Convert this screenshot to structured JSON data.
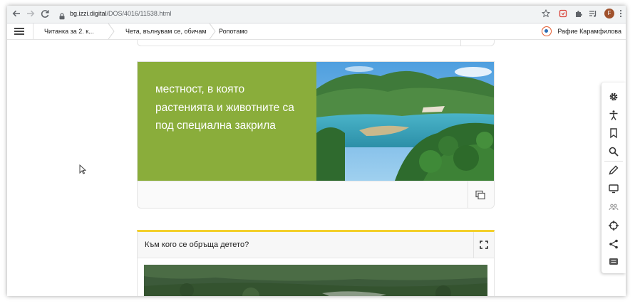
{
  "browser": {
    "url_domain": "bg.izzi.digital",
    "url_path": "/DOS/4016/11538.html",
    "profile_initial": "F"
  },
  "breadcrumb": {
    "items": [
      {
        "label": "Читанка за 2. к..."
      },
      {
        "label": "Чета, вълнувам се, обичам"
      },
      {
        "label": "Ропотамо"
      }
    ]
  },
  "user": {
    "name": "Рафие Карамфилова"
  },
  "card1": {
    "text": "местност, в която растенията и животните са под специална закрила",
    "accent_color": "#8aad3b"
  },
  "card2": {
    "title": "Към кого се обръща детето?",
    "accent_color": "#f3cf2b"
  },
  "toolbar": {
    "tools": [
      "settings-icon",
      "accessibility-icon",
      "bookmark-icon",
      "search-icon",
      "pencil-icon",
      "presentation-icon",
      "users-icon",
      "target-icon",
      "share-icon",
      "chat-icon"
    ]
  }
}
